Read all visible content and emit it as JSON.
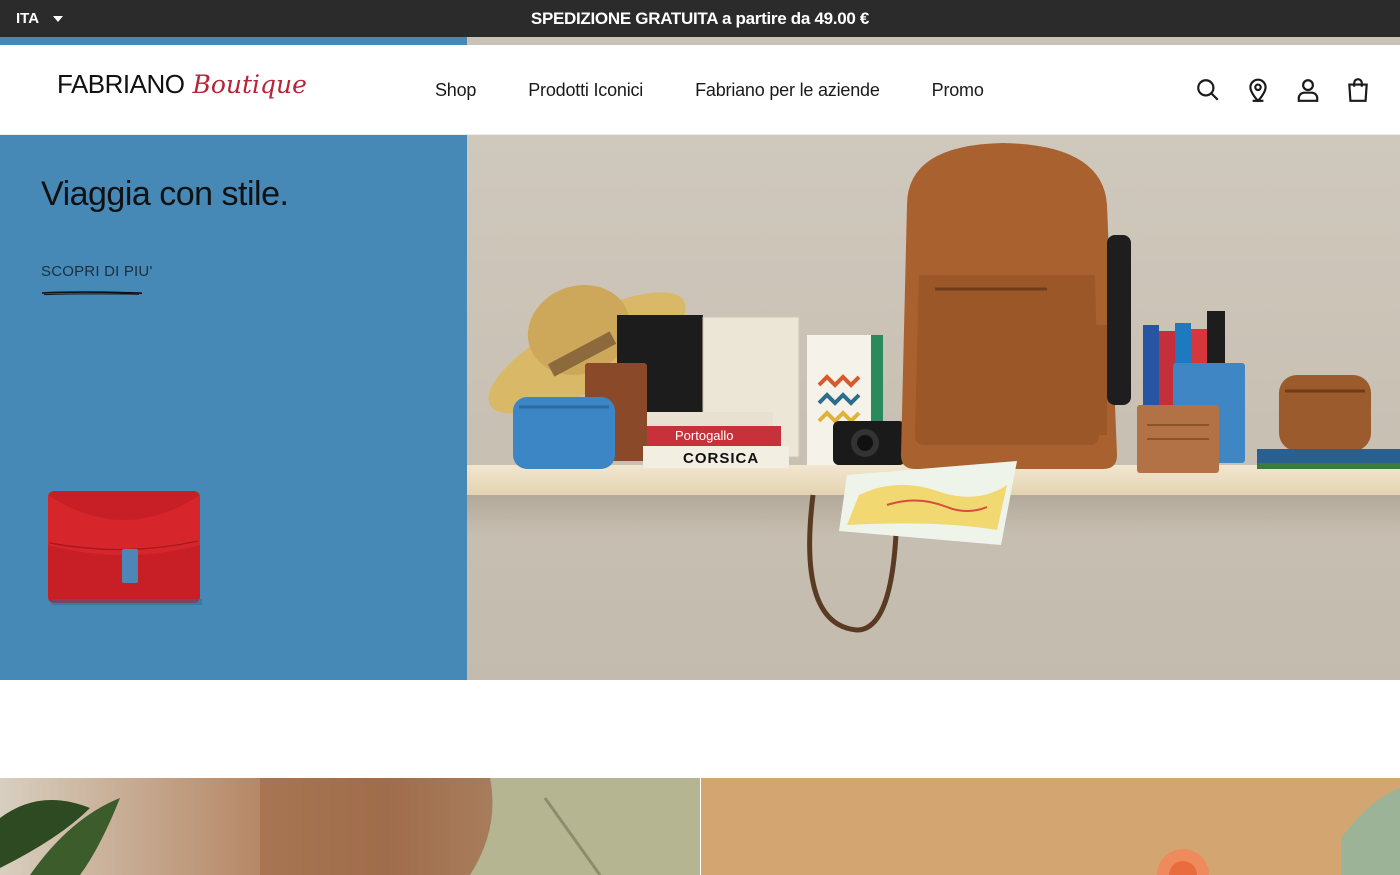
{
  "topbar": {
    "language": "ITA",
    "promo_text": "SPEDIZIONE GRATUITA a partire da 49.00 €"
  },
  "header": {
    "logo_main": "FABRIANO",
    "logo_script": "Boutique",
    "nav": [
      {
        "label": "Shop"
      },
      {
        "label": "Prodotti Iconici"
      },
      {
        "label": "Fabriano per le aziende"
      },
      {
        "label": "Promo"
      }
    ],
    "icons": [
      "search-icon",
      "location-pin-icon",
      "user-icon",
      "shopping-bag-icon"
    ]
  },
  "hero": {
    "title": "Viaggia con stile.",
    "cta": "SCOPRI DI PIU'",
    "book_labels": [
      "Portogallo",
      "CORSICA"
    ]
  },
  "colors": {
    "topbar_bg": "#2b2b2b",
    "hero_blue": "#4689b6",
    "logo_script": "#b5253a",
    "wallet_red": "#d6262c",
    "backpack_brown": "#a8612f"
  }
}
